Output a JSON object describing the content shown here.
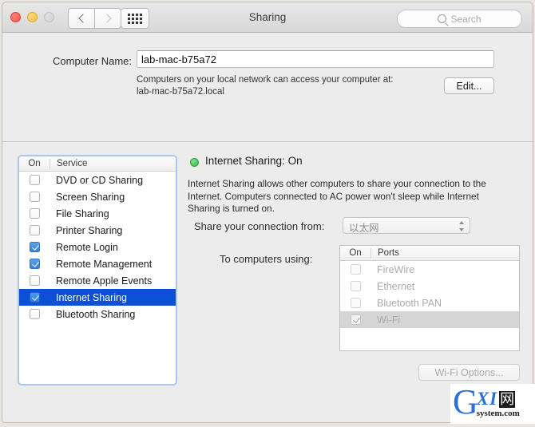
{
  "window": {
    "title": "Sharing",
    "traffic_lights": [
      "close",
      "minimize",
      "zoom"
    ],
    "back_label": "Back",
    "forward_label": "Forward",
    "show_all_label": "Show All",
    "search_placeholder": "Search"
  },
  "computer": {
    "label": "Computer Name:",
    "value": "lab-mac-b75a72",
    "hint_line1": "Computers on your local network can access your computer at:",
    "hint_line2": "lab-mac-b75a72.local",
    "edit_label": "Edit..."
  },
  "services": {
    "header_on": "On",
    "header_service": "Service",
    "items": [
      {
        "label": "DVD or CD Sharing",
        "checked": false,
        "selected": false
      },
      {
        "label": "Screen Sharing",
        "checked": false,
        "selected": false
      },
      {
        "label": "File Sharing",
        "checked": false,
        "selected": false
      },
      {
        "label": "Printer Sharing",
        "checked": false,
        "selected": false
      },
      {
        "label": "Remote Login",
        "checked": true,
        "selected": false
      },
      {
        "label": "Remote Management",
        "checked": true,
        "selected": false
      },
      {
        "label": "Remote Apple Events",
        "checked": false,
        "selected": false
      },
      {
        "label": "Internet Sharing",
        "checked": true,
        "selected": true
      },
      {
        "label": "Bluetooth Sharing",
        "checked": false,
        "selected": false
      }
    ]
  },
  "detail": {
    "status": "Internet Sharing: On",
    "status_color": "#2fbd45",
    "description": "Internet Sharing allows other computers to share your connection to the Internet. Computers connected to AC power won't sleep while Internet Sharing is turned on.",
    "share_from_label": "Share your connection from:",
    "share_from_value": "以太网",
    "to_computers_label": "To computers using:",
    "ports_header_on": "On",
    "ports_header_ports": "Ports",
    "ports": [
      {
        "label": "FireWire",
        "checked": false,
        "selected": false
      },
      {
        "label": "Ethernet",
        "checked": false,
        "selected": false
      },
      {
        "label": "Bluetooth PAN",
        "checked": false,
        "selected": false
      },
      {
        "label": "Wi-Fi",
        "checked": true,
        "selected": true
      }
    ],
    "wifi_options_label": "Wi-Fi Options..."
  },
  "watermark": {
    "letter": "G",
    "xi": "XI",
    "cn": "网",
    "sub": "system.com"
  },
  "colors": {
    "selection_blue": "#0b50d6",
    "checkbox_blue": "#2f81e6",
    "status_green": "#2fbd45",
    "focus_ring": "#a7c7ef"
  }
}
